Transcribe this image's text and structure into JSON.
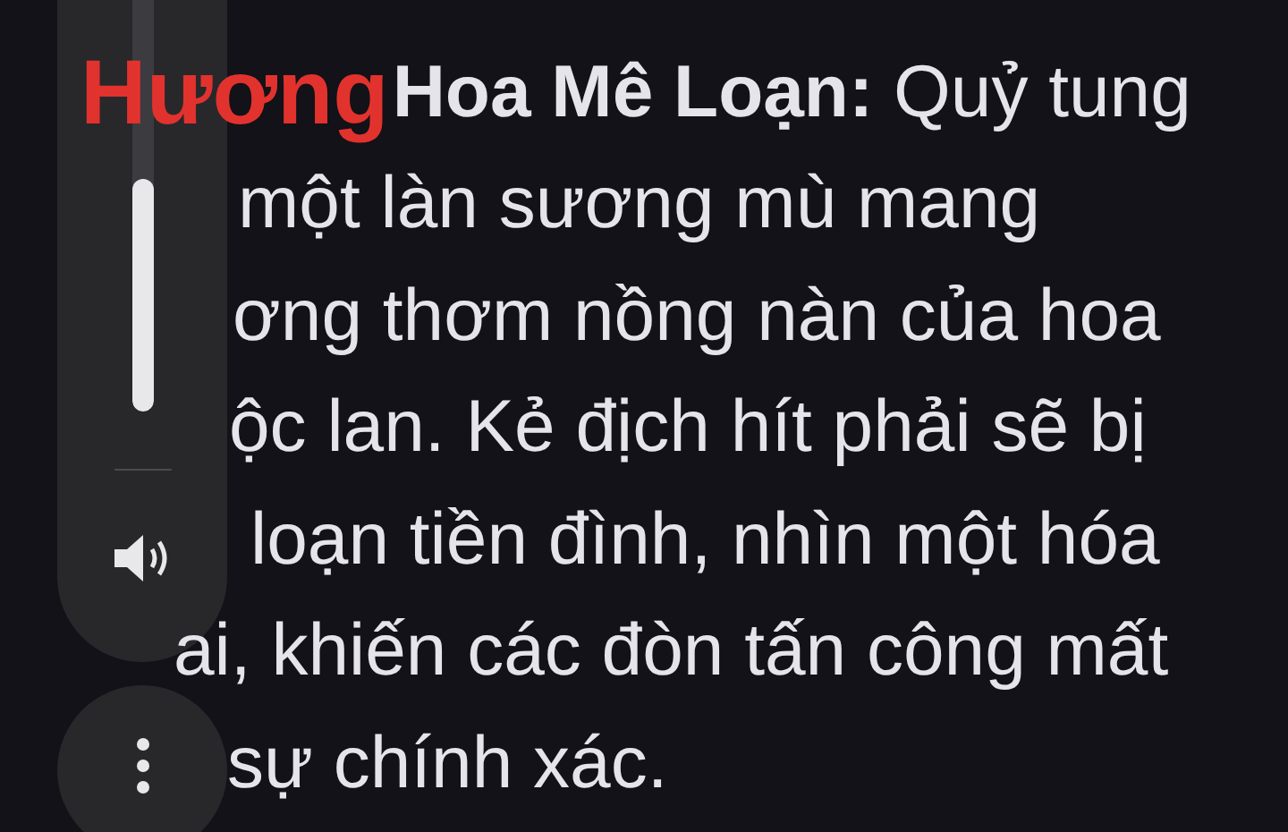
{
  "overlay_caption": "Hương",
  "paragraph_lines": [
    "**Hoa Mê Loạn:** Quỷ tung",
    "một làn sương mù mang",
    "ơng thơm nồng nàn của hoa",
    "ộc lan. Kẻ địch hít phải sẽ bị",
    "loạn tiền đình, nhìn một hóa",
    "ai, khiến các đòn tấn công mất",
    "sự chính xác."
  ],
  "volume": {
    "level": 0.48
  }
}
